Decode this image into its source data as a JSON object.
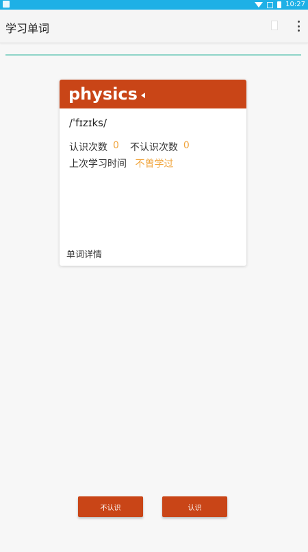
{
  "status_bar": {
    "time": "10:27"
  },
  "app_bar": {
    "title": "学习单词",
    "overflow_icon": "more-vert-icon"
  },
  "card": {
    "word": "physics",
    "speaker_icon": "speaker-icon",
    "phonetic": "/ˈfɪzɪks/",
    "known_label": "认识次数",
    "known_count": "0",
    "unknown_label": "不认识次数",
    "unknown_count": "0",
    "last_study_label": "上次学习时间",
    "last_study_value": "不曾学过",
    "details_link": "单词详情"
  },
  "buttons": {
    "unknown": "不认识",
    "known": "认识"
  },
  "colors": {
    "accent": "#c94517",
    "highlight": "#f0a43c",
    "status_bar": "#1eb0e6",
    "progress": "#8fd4c8"
  }
}
